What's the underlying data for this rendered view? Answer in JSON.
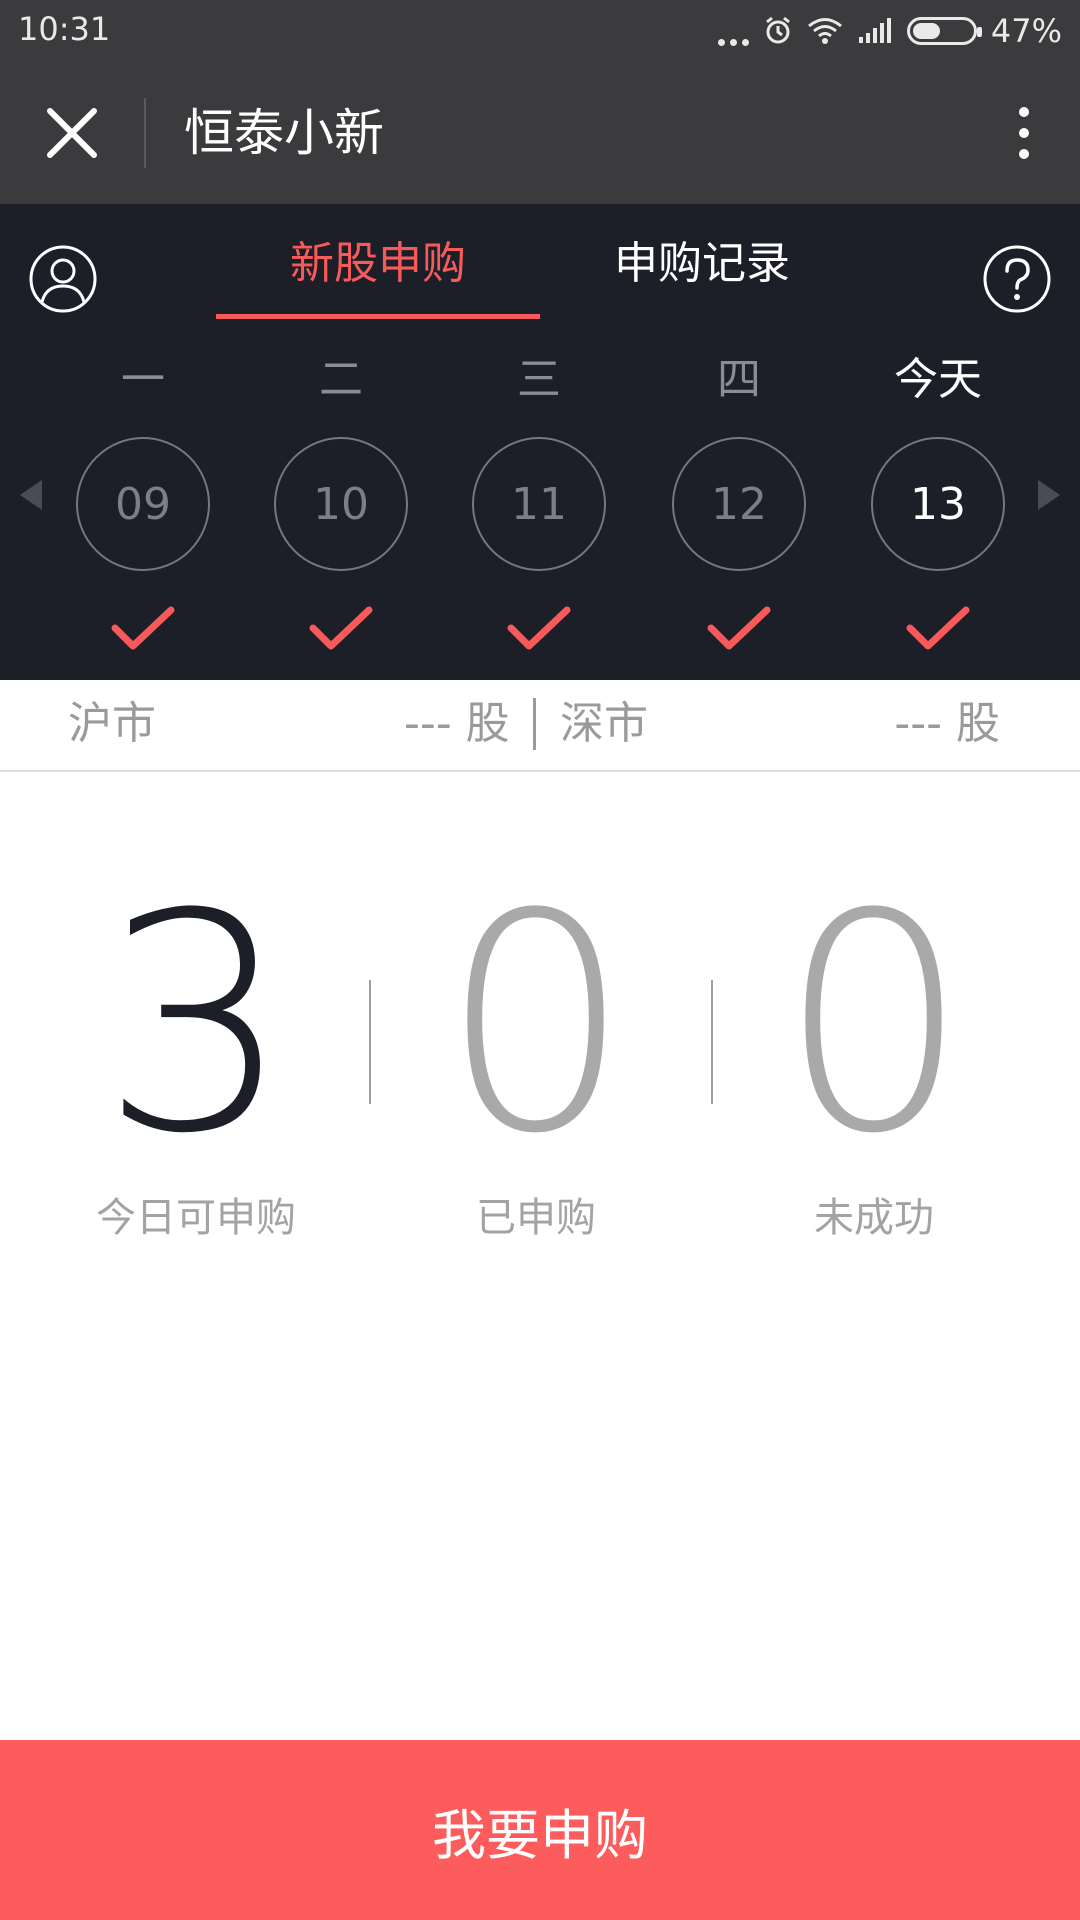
{
  "status_bar": {
    "time": "10:31",
    "battery": "47%",
    "battery_level": 0.47
  },
  "header": {
    "title": "恒泰小新"
  },
  "tabs": [
    {
      "label": "新股申购",
      "active": true
    },
    {
      "label": "申购记录",
      "active": false
    }
  ],
  "calendar": {
    "days": [
      {
        "weekday": "一",
        "date": "09",
        "checked": true
      },
      {
        "weekday": "二",
        "date": "10",
        "checked": true
      },
      {
        "weekday": "三",
        "date": "11",
        "checked": true
      },
      {
        "weekday": "四",
        "date": "12",
        "checked": true
      },
      {
        "weekday": "今天",
        "date": "13",
        "checked": true
      }
    ]
  },
  "market": {
    "sh_label": "沪市",
    "sh_value": "--- 股",
    "sz_label": "深市",
    "sz_value": "--- 股"
  },
  "stats": [
    {
      "value": "3",
      "label": "今日可申购"
    },
    {
      "value": "0",
      "label": "已申购"
    },
    {
      "value": "0",
      "label": "未成功"
    }
  ],
  "cta": {
    "label": "我要申购"
  },
  "colors": {
    "accent": "#fd5c5c",
    "dark_bg": "#1c1e28",
    "titlebar_bg": "#3b3b3d"
  }
}
